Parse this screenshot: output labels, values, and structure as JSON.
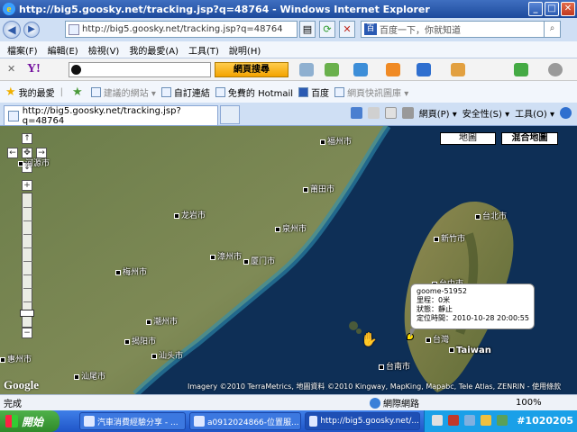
{
  "window": {
    "title": "http://big5.goosky.net/tracking.jsp?q=48764 - Windows Internet Explorer",
    "minimize": "_",
    "maximize": "□",
    "close": "✕"
  },
  "address": {
    "url": "http://big5.goosky.net/tracking.jsp?q=48764",
    "search_placeholder": "百度一下，你就知道"
  },
  "menu": [
    "檔案(F)",
    "編輯(E)",
    "檢視(V)",
    "我的最愛(A)",
    "工具(T)",
    "說明(H)"
  ],
  "yahoo_bar": {
    "logo": "Y!",
    "search_button": "網頁搜尋"
  },
  "favorites": {
    "label": "我的最愛",
    "items": [
      "建議的網站 ▾",
      "自訂連結",
      "免費的 Hotmail",
      "百度",
      "網頁快訊圖庫 ▾"
    ]
  },
  "tab": {
    "title": "http://big5.goosky.net/tracking.jsp?q=48764"
  },
  "command_bar": [
    "網頁(P) ▾",
    "安全性(S) ▾",
    "工具(O) ▾"
  ],
  "map": {
    "buttons": [
      "地圖",
      "混合地圖"
    ],
    "cities": [
      "福州市",
      "莆田市",
      "泉州市",
      "龙岩市",
      "漳州市",
      "厦门市",
      "梅州市",
      "潮州市",
      "揭阳市",
      "汕头市",
      "汕尾市",
      "河源市",
      "惠州市",
      "台北市",
      "新竹市",
      "台中市",
      "台灣",
      "Taiwan",
      "台南市"
    ],
    "popup": {
      "device": "goome-51952",
      "mileage_label": "里程：",
      "mileage": "0米",
      "status_label": "狀態：",
      "status": "靜止",
      "time_label": "定位時間：",
      "time": "2010-10-28 20:00:55"
    },
    "copyright": "Imagery ©2010 TerraMetrics, 地圖資料 ©2010 Kingway, MapKing, Mapabc, Tele Atlas, ZENRIN - 使用條款",
    "logo": "Google"
  },
  "status": {
    "text": "完成",
    "zone": "網際網路",
    "zoom": "100%"
  },
  "taskbar": {
    "start": "開始",
    "items": [
      "汽車消費經驗分享 - ...",
      "a0912024866-位置服...",
      "http://big5.goosky.net/..."
    ],
    "clock": "#1020205"
  },
  "colors": {
    "title_blue": "#1d4a9c",
    "sea": "#0d2d52",
    "taskbar_blue": "#245edb",
    "start_green": "#3c9a35"
  }
}
